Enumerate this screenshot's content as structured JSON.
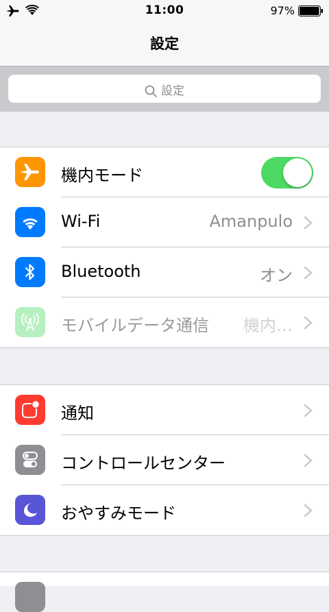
{
  "status_bar": {
    "time": "11:00",
    "battery_percent": "97%"
  },
  "nav": {
    "title": "設定"
  },
  "search": {
    "placeholder": "設定"
  },
  "group1": {
    "items": [
      {
        "label": "機内モード",
        "icon": "airplane-icon",
        "color": "#ff9500",
        "toggle_on": true
      },
      {
        "label": "Wi-Fi",
        "detail": "Amanpulo",
        "icon": "wifi-icon",
        "color": "#007aff"
      },
      {
        "label": "Bluetooth",
        "detail": "オン",
        "icon": "bluetooth-icon",
        "color": "#007aff"
      },
      {
        "label": "モバイルデータ通信",
        "detail": "機内…",
        "icon": "antenna-icon",
        "color": "#4cd964",
        "disabled": true
      }
    ]
  },
  "group2": {
    "items": [
      {
        "label": "通知",
        "icon": "notifications-icon",
        "color": "#ff3b30"
      },
      {
        "label": "コントロールセンター",
        "icon": "control-center-icon",
        "color": "#8e8e93"
      },
      {
        "label": "おやすみモード",
        "icon": "moon-icon",
        "color": "#5856d6"
      }
    ]
  }
}
